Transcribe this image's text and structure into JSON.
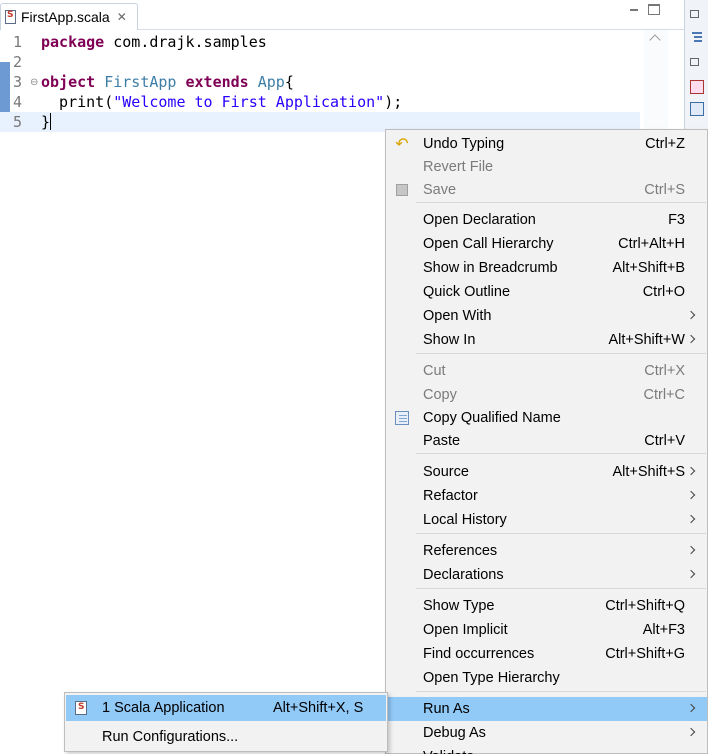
{
  "editor": {
    "tab": {
      "title": "FirstApp.scala",
      "close_glyph": "✕"
    },
    "lines": [
      {
        "no": "1",
        "parts": [
          {
            "t": "package",
            "c": "kw"
          },
          {
            "t": " com.drajk.samples",
            "c": ""
          }
        ]
      },
      {
        "no": "2",
        "parts": []
      },
      {
        "no": "3",
        "parts": [
          {
            "t": "object",
            "c": "kw"
          },
          {
            "t": " ",
            "c": ""
          },
          {
            "t": "FirstApp",
            "c": "obj"
          },
          {
            "t": " ",
            "c": ""
          },
          {
            "t": "extends",
            "c": "kw"
          },
          {
            "t": " ",
            "c": ""
          },
          {
            "t": "App",
            "c": "obj"
          },
          {
            "t": "{",
            "c": ""
          }
        ]
      },
      {
        "no": "4",
        "parts": [
          {
            "t": "  print(",
            "c": ""
          },
          {
            "t": "\"Welcome to First Application\"",
            "c": "str"
          },
          {
            "t": ");",
            "c": ""
          }
        ]
      },
      {
        "no": "5",
        "parts": [
          {
            "t": "}",
            "c": ""
          }
        ]
      }
    ]
  },
  "context_menu": {
    "items": [
      {
        "label": "Undo Typing",
        "shortcut": "Ctrl+Z",
        "icon": "undo-icon",
        "enabled": true,
        "submenu": false
      },
      {
        "label": "Revert File",
        "shortcut": "",
        "icon": "",
        "enabled": false,
        "submenu": false
      },
      {
        "label": "Save",
        "shortcut": "Ctrl+S",
        "icon": "save-icon",
        "enabled": false,
        "submenu": false
      },
      {
        "label": "Open Declaration",
        "shortcut": "F3",
        "icon": "",
        "enabled": true,
        "submenu": false
      },
      {
        "label": "Open Call Hierarchy",
        "shortcut": "Ctrl+Alt+H",
        "icon": "",
        "enabled": true,
        "submenu": false
      },
      {
        "label": "Show in Breadcrumb",
        "shortcut": "Alt+Shift+B",
        "icon": "",
        "enabled": true,
        "submenu": false
      },
      {
        "label": "Quick Outline",
        "shortcut": "Ctrl+O",
        "icon": "",
        "enabled": true,
        "submenu": false
      },
      {
        "label": "Open With",
        "shortcut": "",
        "icon": "",
        "enabled": true,
        "submenu": true
      },
      {
        "label": "Show In",
        "shortcut": "Alt+Shift+W",
        "icon": "",
        "enabled": true,
        "submenu": true
      },
      {
        "label": "Cut",
        "shortcut": "Ctrl+X",
        "icon": "",
        "enabled": false,
        "submenu": false
      },
      {
        "label": "Copy",
        "shortcut": "Ctrl+C",
        "icon": "",
        "enabled": false,
        "submenu": false
      },
      {
        "label": "Copy Qualified Name",
        "shortcut": "",
        "icon": "copy-qualified-icon",
        "enabled": true,
        "submenu": false
      },
      {
        "label": "Paste",
        "shortcut": "Ctrl+V",
        "icon": "",
        "enabled": true,
        "submenu": false
      },
      {
        "label": "Source",
        "shortcut": "Alt+Shift+S",
        "icon": "",
        "enabled": true,
        "submenu": true
      },
      {
        "label": "Refactor",
        "shortcut": "",
        "icon": "",
        "enabled": true,
        "submenu": true
      },
      {
        "label": "Local History",
        "shortcut": "",
        "icon": "",
        "enabled": true,
        "submenu": true
      },
      {
        "label": "References",
        "shortcut": "",
        "icon": "",
        "enabled": true,
        "submenu": true
      },
      {
        "label": "Declarations",
        "shortcut": "",
        "icon": "",
        "enabled": true,
        "submenu": true
      },
      {
        "label": "Show Type",
        "shortcut": "Ctrl+Shift+Q",
        "icon": "",
        "enabled": true,
        "submenu": false
      },
      {
        "label": "Open Implicit",
        "shortcut": "Alt+F3",
        "icon": "",
        "enabled": true,
        "submenu": false
      },
      {
        "label": "Find occurrences",
        "shortcut": "Ctrl+Shift+G",
        "icon": "",
        "enabled": true,
        "submenu": false
      },
      {
        "label": "Open Type Hierarchy",
        "shortcut": "",
        "icon": "",
        "enabled": true,
        "submenu": false
      },
      {
        "label": "Run As",
        "shortcut": "",
        "icon": "",
        "enabled": true,
        "submenu": true,
        "highlighted": true
      },
      {
        "label": "Debug As",
        "shortcut": "",
        "icon": "",
        "enabled": true,
        "submenu": true
      },
      {
        "label": "Validate",
        "shortcut": "",
        "icon": "",
        "enabled": true,
        "submenu": false
      }
    ]
  },
  "run_as_submenu": {
    "items": [
      {
        "label": "1 Scala Application",
        "shortcut": "Alt+Shift+X, S",
        "icon": "scala-file-icon",
        "highlighted": true
      },
      {
        "label": "Run Configurations...",
        "shortcut": "",
        "icon": "",
        "highlighted": false
      }
    ]
  },
  "colors": {
    "highlight": "#91c9f7",
    "keyword": "#7f0055",
    "string": "#2a00ff",
    "type_name": "#3d7ea6"
  }
}
